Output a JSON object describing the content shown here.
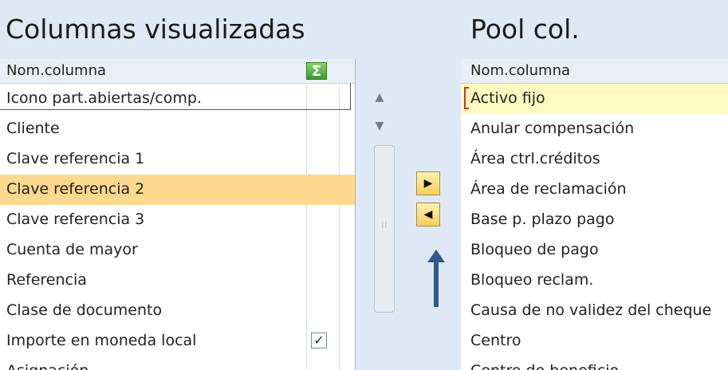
{
  "left_pane": {
    "title": "Columnas visualizadas",
    "header_label": "Nom.columna",
    "rows": [
      {
        "label": "Icono part.abiertas/comp.",
        "checked": false
      },
      {
        "label": "Cliente",
        "checked": false
      },
      {
        "label": "Clave referencia 1",
        "checked": false
      },
      {
        "label": "Clave referencia 2",
        "checked": false,
        "selected": true
      },
      {
        "label": "Clave referencia 3",
        "checked": false
      },
      {
        "label": "Cuenta de mayor",
        "checked": false
      },
      {
        "label": "Referencia",
        "checked": false
      },
      {
        "label": "Clase de documento",
        "checked": false
      },
      {
        "label": "Importe en moneda local",
        "checked": true
      },
      {
        "label": "Asignación",
        "checked": false
      }
    ]
  },
  "right_pane": {
    "title": "Pool col.",
    "header_label": "Nom.columna",
    "rows": [
      "Activo fijo",
      "Anular compensación",
      "Área ctrl.créditos",
      "Área de reclamación",
      "Base p. plazo pago",
      "Bloqueo de pago",
      "Bloqueo reclam.",
      "Causa de no validez del cheque",
      "Centro",
      "Centro de beneficio"
    ]
  },
  "controls": {
    "sum_icon": "Σ",
    "move_right_icon": "▶",
    "move_left_icon": "◀",
    "checkbox_mark": "✓"
  },
  "colors": {
    "selected_row": "#fcd98f",
    "highlight_row": "#fffac0",
    "background": "#dfe9f5",
    "arrow": "#2e5b8a"
  }
}
